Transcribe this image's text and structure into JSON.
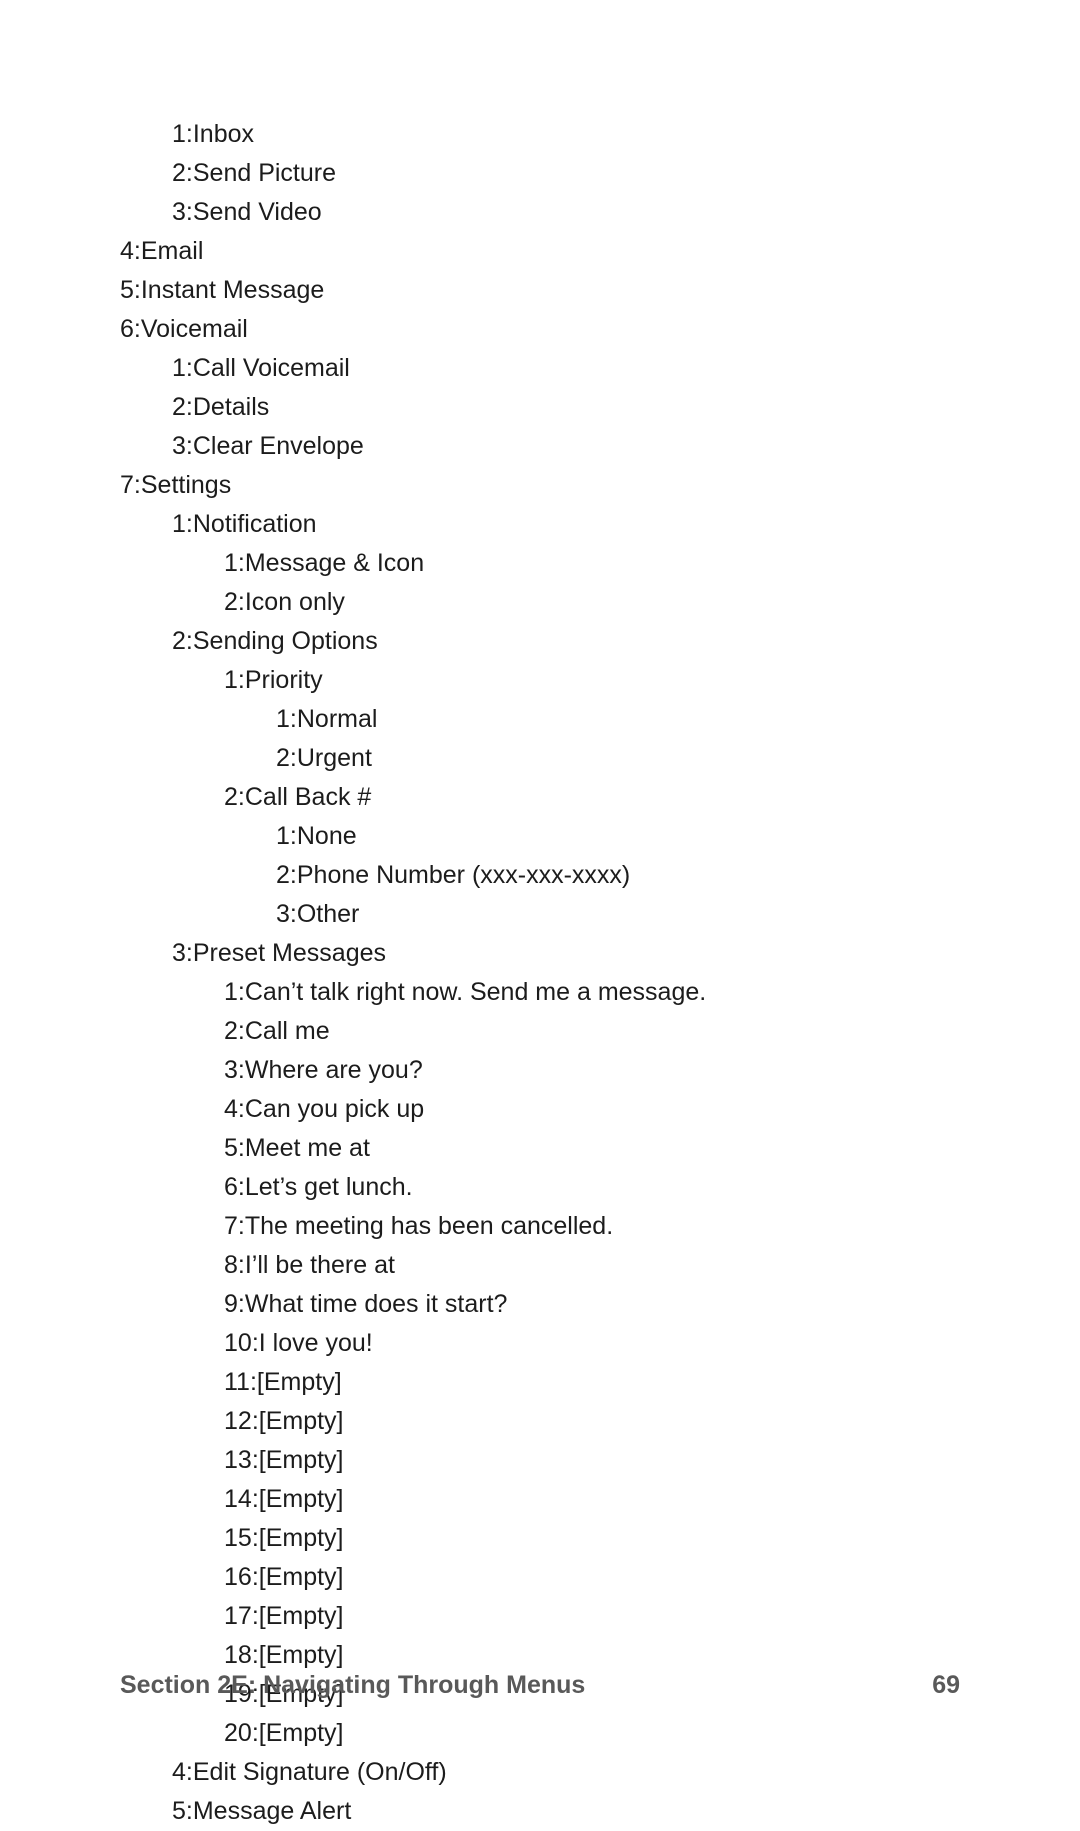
{
  "footer": {
    "section_label": "Section 2E: Navigating Through Menus",
    "page_number": "69"
  },
  "menu": [
    {
      "level": 1,
      "num": "1",
      "text": "Inbox"
    },
    {
      "level": 1,
      "num": "2",
      "text": "Send Picture"
    },
    {
      "level": 1,
      "num": "3",
      "text": "Send Video"
    },
    {
      "level": 0,
      "num": "4",
      "text": "Email"
    },
    {
      "level": 0,
      "num": "5",
      "text": "Instant Message"
    },
    {
      "level": 0,
      "num": "6",
      "text": "Voicemail"
    },
    {
      "level": 1,
      "num": "1",
      "text": "Call Voicemail"
    },
    {
      "level": 1,
      "num": "2",
      "text": "Details"
    },
    {
      "level": 1,
      "num": "3",
      "text": "Clear Envelope"
    },
    {
      "level": 0,
      "num": "7",
      "text": "Settings"
    },
    {
      "level": 1,
      "num": "1",
      "text": "Notification"
    },
    {
      "level": 2,
      "num": "1",
      "text": "Message & Icon"
    },
    {
      "level": 2,
      "num": "2",
      "text": "Icon only"
    },
    {
      "level": 1,
      "num": "2",
      "text": "Sending Options"
    },
    {
      "level": 2,
      "num": "1",
      "text": "Priority"
    },
    {
      "level": 3,
      "num": "1",
      "text": "Normal"
    },
    {
      "level": 3,
      "num": "2",
      "text": "Urgent"
    },
    {
      "level": 2,
      "num": "2",
      "text": "Call Back #"
    },
    {
      "level": 3,
      "num": "1",
      "text": "None"
    },
    {
      "level": 3,
      "num": "2",
      "text": "Phone Number (xxx-xxx-xxxx)"
    },
    {
      "level": 3,
      "num": "3",
      "text": "Other"
    },
    {
      "level": 1,
      "num": "3",
      "text": "Preset Messages"
    },
    {
      "level": 2,
      "num": "1",
      "text": "Can’t talk right now. Send me a message."
    },
    {
      "level": 2,
      "num": "2",
      "text": "Call me"
    },
    {
      "level": 2,
      "num": "3",
      "text": "Where are you?"
    },
    {
      "level": 2,
      "num": "4",
      "text": "Can you pick up"
    },
    {
      "level": 2,
      "num": "5",
      "text": "Meet me at"
    },
    {
      "level": 2,
      "num": "6",
      "text": "Let’s get lunch."
    },
    {
      "level": 2,
      "num": "7",
      "text": "The meeting has been cancelled."
    },
    {
      "level": 2,
      "num": "8",
      "text": "I’ll be there at"
    },
    {
      "level": 2,
      "num": "9",
      "text": "What time does it start?"
    },
    {
      "level": 2,
      "num": "10",
      "text": "I love you!"
    },
    {
      "level": 2,
      "num": "11",
      "text": "[Empty]"
    },
    {
      "level": 2,
      "num": "12",
      "text": "[Empty]"
    },
    {
      "level": 2,
      "num": "13",
      "text": "[Empty]"
    },
    {
      "level": 2,
      "num": "14",
      "text": "[Empty]"
    },
    {
      "level": 2,
      "num": "15",
      "text": "[Empty]"
    },
    {
      "level": 2,
      "num": "16",
      "text": "[Empty]"
    },
    {
      "level": 2,
      "num": "17",
      "text": "[Empty]"
    },
    {
      "level": 2,
      "num": "18",
      "text": "[Empty]"
    },
    {
      "level": 2,
      "num": "19",
      "text": "[Empty]"
    },
    {
      "level": 2,
      "num": "20",
      "text": "[Empty]"
    },
    {
      "level": 1,
      "num": "4",
      "text": "Edit Signature (On/Off)"
    },
    {
      "level": 1,
      "num": "5",
      "text": "Message Alert"
    }
  ],
  "separator": ": "
}
